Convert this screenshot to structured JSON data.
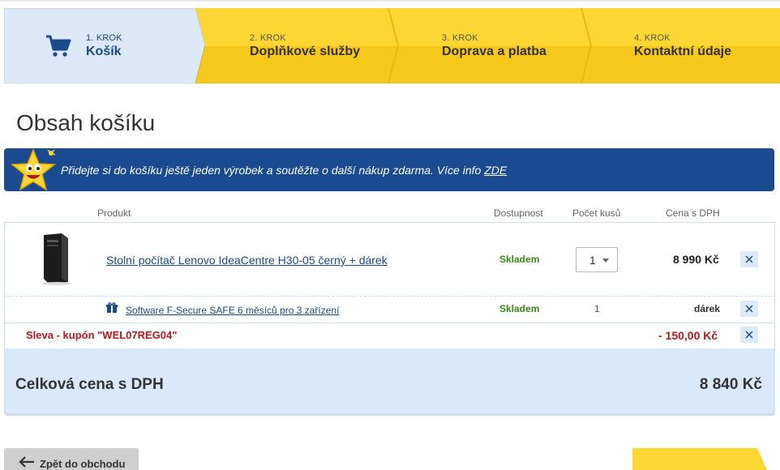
{
  "steps": [
    {
      "num": "1. KROK",
      "title": "Košík"
    },
    {
      "num": "2. KROK",
      "title": "Doplňkové služby"
    },
    {
      "num": "3. KROK",
      "title": "Doprava a platba"
    },
    {
      "num": "4. KROK",
      "title": "Kontaktní údaje"
    }
  ],
  "page_title": "Obsah košíku",
  "promo": {
    "text": "Přidejte si do košíku ještě jeden výrobek a soutěžte o další nákup zdarma. Více info ",
    "link": "ZDE"
  },
  "table": {
    "headers": {
      "product": "Produkt",
      "availability": "Dostupnost",
      "quantity": "Počet kusů",
      "price": "Cena s DPH"
    },
    "items": [
      {
        "name": "Stolní počítač Lenovo IdeaCentre H30-05 černý + dárek",
        "availability": "Skladem",
        "quantity": "1",
        "price": "8 990 Kč"
      }
    ],
    "gift": {
      "name": "Software F-Secure SAFE 6 měsíců pro 3 zařízení",
      "availability": "Skladem",
      "quantity": "1",
      "price": "dárek"
    },
    "coupon": {
      "label": "Sleva - kupón \"WEL07REG04\"",
      "value": "- 150,00 Kč"
    }
  },
  "total": {
    "label": "Celková cena s DPH",
    "value": "8 840 Kč"
  },
  "buttons": {
    "back": "Zpět do obchodu"
  },
  "colors": {
    "accent_blue": "#1a4a8f",
    "step_yellow": "#fdd835",
    "step_active": "#dde9f7",
    "stock_green": "#3a8a1a",
    "coupon_red": "#c0141e"
  }
}
